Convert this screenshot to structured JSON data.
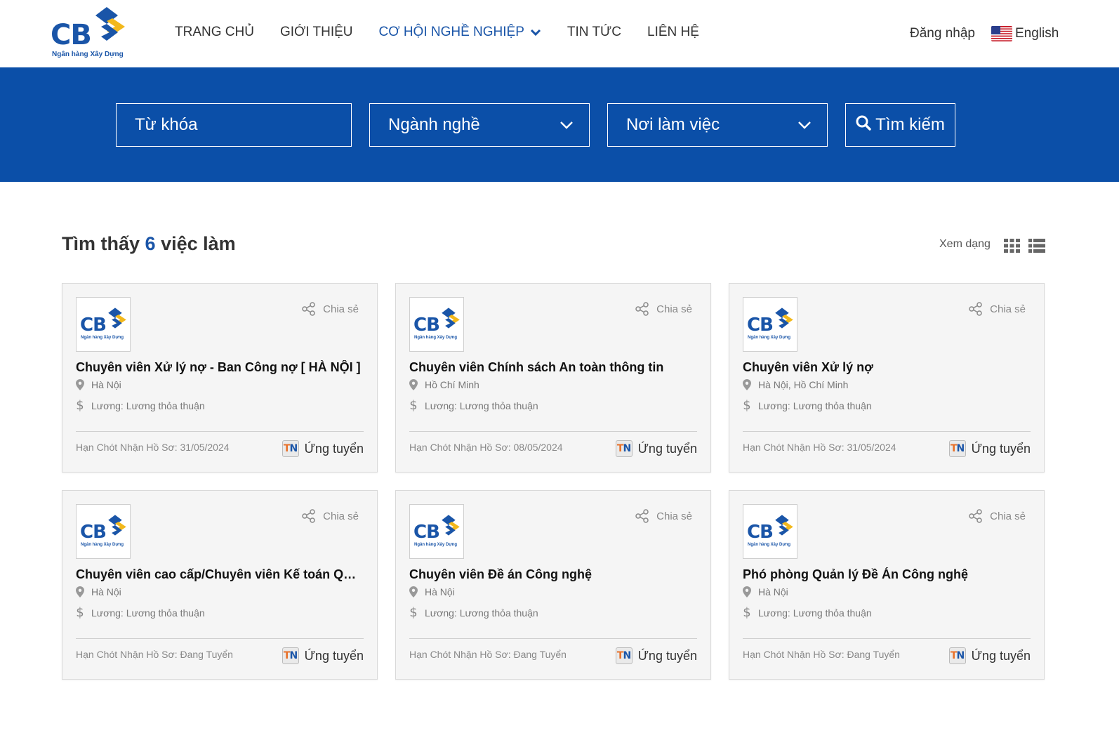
{
  "brand": {
    "logo_text": "CB",
    "logo_tagline": "Ngân hàng Xây Dựng",
    "primary_color": "#1a55a8",
    "band_color": "#0b4fa8"
  },
  "nav": {
    "items": [
      {
        "label": "TRANG CHỦ"
      },
      {
        "label": "GIỚI THIỆU"
      },
      {
        "label": "CƠ HỘI NGHỀ NGHIỆP"
      },
      {
        "label": "TIN TỨC"
      },
      {
        "label": "LIÊN HỆ"
      }
    ],
    "active": "CƠ HỘI NGHỀ NGHIỆP",
    "login_label": "Đăng nhập",
    "language_label": "English"
  },
  "search": {
    "keyword_placeholder": "Từ khóa",
    "industry_label": "Ngành nghề",
    "location_label": "Nơi làm việc",
    "button_label": "Tìm kiếm"
  },
  "results": {
    "prefix": "Tìm thấy",
    "count": "6",
    "suffix": "việc làm",
    "view_mode_label": "Xem dạng"
  },
  "jobs": [
    {
      "share_label": "Chia sẻ",
      "title": "Chuyên viên Xử lý nợ - Ban Công nợ [ HÀ NỘI ]",
      "location": "Hà Nội",
      "salary": "Lương: Lương thỏa thuận",
      "deadline": "Hạn Chót Nhận Hồ Sơ: 31/05/2024",
      "apply_label": "Ứng tuyển"
    },
    {
      "share_label": "Chia sẻ",
      "title": "Chuyên viên Chính sách An toàn thông tin",
      "location": "Hồ Chí Minh",
      "salary": "Lương: Lương thỏa thuận",
      "deadline": "Hạn Chót Nhận Hồ Sơ: 08/05/2024",
      "apply_label": "Ứng tuyển"
    },
    {
      "share_label": "Chia sẻ",
      "title": "Chuyên viên Xử lý nợ",
      "location": "Hà Nội, Hồ Chí Minh",
      "salary": "Lương: Lương thỏa thuận",
      "deadline": "Hạn Chót Nhận Hồ Sơ: 31/05/2024",
      "apply_label": "Ứng tuyển"
    },
    {
      "share_label": "Chia sẻ",
      "title": "Chuyên viên cao cấp/Chuyên viên Kế toán Quả...",
      "location": "Hà Nội",
      "salary": "Lương: Lương thỏa thuận",
      "deadline": "Hạn Chót Nhận Hồ Sơ: Đang Tuyển",
      "apply_label": "Ứng tuyển"
    },
    {
      "share_label": "Chia sẻ",
      "title": "Chuyên viên Đề án Công nghệ",
      "location": "Hà Nội",
      "salary": "Lương: Lương thỏa thuận",
      "deadline": "Hạn Chót Nhận Hồ Sơ: Đang Tuyển",
      "apply_label": "Ứng tuyển"
    },
    {
      "share_label": "Chia sẻ",
      "title": "Phó phòng Quản lý Đề Án Công nghệ",
      "location": "Hà Nội",
      "salary": "Lương: Lương thỏa thuận",
      "deadline": "Hạn Chót Nhận Hồ Sơ: Đang Tuyển",
      "apply_label": "Ứng tuyển"
    }
  ],
  "icons": {
    "logo_mark": "cb-diamond-logo-icon",
    "nav_dropdown": "chevron-down-icon",
    "language_flag": "us-flag-icon",
    "select_dropdown": "chevron-down-icon",
    "search": "search-icon",
    "grid_view": "grid-view-icon",
    "list_view": "list-view-icon",
    "share": "share-icon",
    "location": "map-pin-icon",
    "salary": "dollar-icon",
    "apply": "tn-badge-icon"
  }
}
